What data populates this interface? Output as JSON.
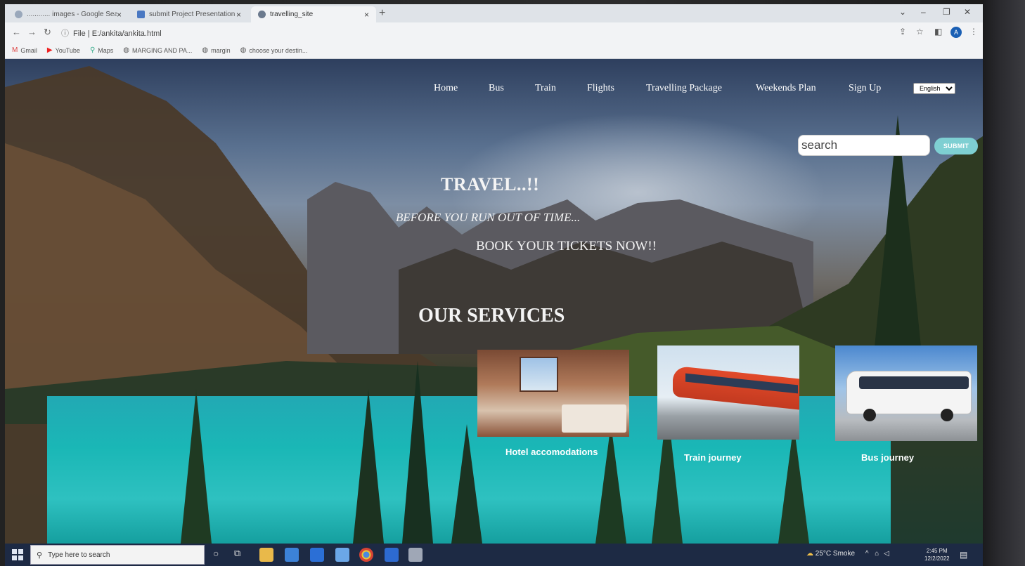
{
  "browser": {
    "tabs": [
      {
        "label": "............ images - Google Sear",
        "active": false
      },
      {
        "label": "submit Project Presentation PPT",
        "active": false
      },
      {
        "label": "travelling_site",
        "active": true
      }
    ],
    "url": "File | E:/ankita/ankita.html",
    "bookmarks": [
      "Gmail",
      "YouTube",
      "Maps",
      "MARGING AND PA...",
      "margin",
      "choose your destin..."
    ],
    "avatar_letter": "A"
  },
  "site": {
    "nav": [
      "Home",
      "Bus",
      "Train",
      "Flights",
      "Travelling Package",
      "Weekends Plan",
      "Sign Up"
    ],
    "language": "English",
    "search_placeholder": "search",
    "submit_label": "SUBMIT",
    "hero_title": "TRAVEL..!!",
    "hero_subtitle": "BEFORE YOU RUN OUT OF TIME...",
    "hero_cta": "BOOK YOUR TICKETS NOW!!",
    "services_title": "OUR SERVICES",
    "services": [
      {
        "label": "Hotel accomodations",
        "icon": "hotel-room-image"
      },
      {
        "label": "Train journey",
        "icon": "train-image"
      },
      {
        "label": "Bus journey",
        "icon": "bus-image"
      }
    ]
  },
  "taskbar": {
    "search_placeholder": "Type here to search",
    "weather": "25°C  Smoke",
    "time": "2:45 PM",
    "date": "12/2/2022"
  }
}
